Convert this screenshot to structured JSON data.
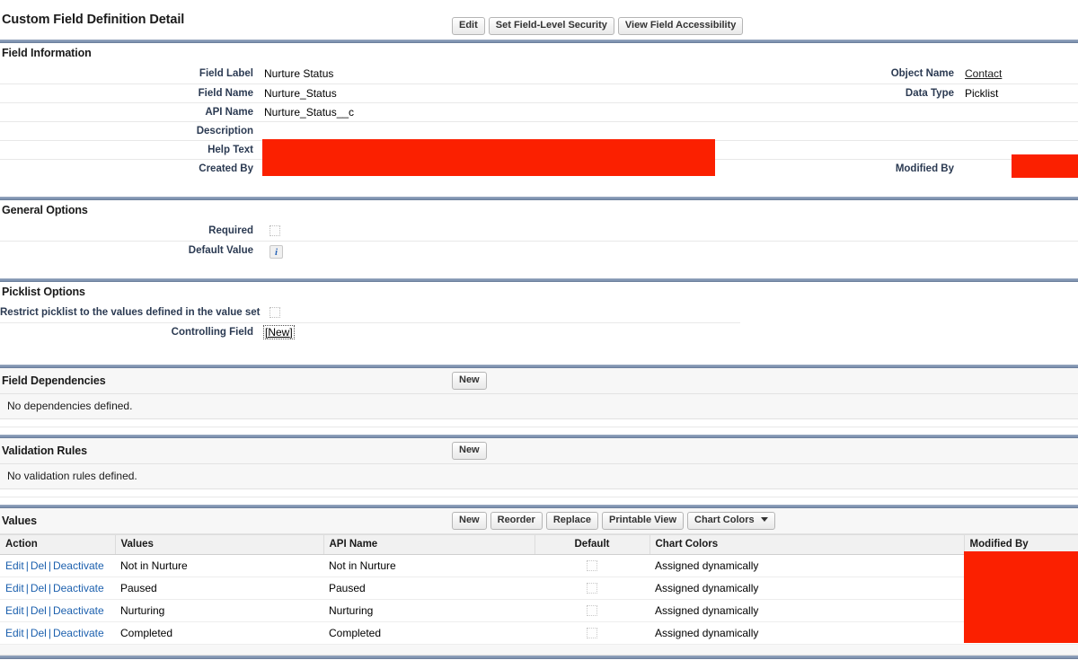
{
  "page": {
    "title": "Custom Field Definition Detail",
    "header_buttons": [
      {
        "label": "Edit",
        "name": "edit-button"
      },
      {
        "label": "Set Field-Level Security",
        "name": "set-field-level-security-button"
      },
      {
        "label": "View Field Accessibility",
        "name": "view-field-accessibility-button"
      }
    ]
  },
  "field_information": {
    "section_title": "Field Information",
    "left_rows": [
      {
        "label": "Field Label",
        "value": "Nurture Status"
      },
      {
        "label": "Field Name",
        "value": "Nurture_Status"
      },
      {
        "label": "API Name",
        "value": "Nurture_Status__c"
      },
      {
        "label": "Description",
        "value": ""
      },
      {
        "label": "Help Text",
        "value": ""
      },
      {
        "label": "Created By",
        "value": ""
      }
    ],
    "right_rows": [
      {
        "label": "Object Name",
        "value": "Contact",
        "link": true
      },
      {
        "label": "Data Type",
        "value": "Picklist",
        "link": false
      },
      {
        "label": "",
        "value": ""
      },
      {
        "label": "",
        "value": ""
      },
      {
        "label": "",
        "value": ""
      },
      {
        "label": "Modified By",
        "value": ""
      }
    ]
  },
  "general_options": {
    "section_title": "General Options",
    "rows": [
      {
        "label": "Required",
        "control": "checkbox-unchecked"
      },
      {
        "label": "Default Value",
        "control": "info-icon"
      }
    ]
  },
  "picklist_options": {
    "section_title": "Picklist Options",
    "restrict_label": "Restrict picklist to the values defined in the value set",
    "restrict_control": "checkbox-unchecked",
    "controlling_field_label": "Controlling Field",
    "controlling_field_value": "[New]"
  },
  "field_dependencies": {
    "title": "Field Dependencies",
    "new_button": "New",
    "empty_message": "No dependencies defined."
  },
  "validation_rules": {
    "title": "Validation Rules",
    "new_button": "New",
    "empty_message": "No validation rules defined."
  },
  "values": {
    "title": "Values",
    "buttons": [
      {
        "label": "New",
        "name": "values-new-button",
        "dropdown": false
      },
      {
        "label": "Reorder",
        "name": "values-reorder-button",
        "dropdown": false
      },
      {
        "label": "Replace",
        "name": "values-replace-button",
        "dropdown": false
      },
      {
        "label": "Printable View",
        "name": "values-printable-view-button",
        "dropdown": false
      },
      {
        "label": "Chart Colors",
        "name": "values-chart-colors-dropdown",
        "dropdown": true
      }
    ],
    "columns": [
      "Action",
      "Values",
      "API Name",
      "Default",
      "Chart Colors",
      "Modified By"
    ],
    "action_links": [
      "Edit",
      "Del",
      "Deactivate"
    ],
    "action_separator": "|",
    "rows": [
      {
        "value": "Not in Nurture",
        "api_name": "Not in Nurture",
        "default": false,
        "chart_colors": "Assigned dynamically",
        "modified_by": ""
      },
      {
        "value": "Paused",
        "api_name": "Paused",
        "default": false,
        "chart_colors": "Assigned dynamically",
        "modified_by": ""
      },
      {
        "value": "Nurturing",
        "api_name": "Nurturing",
        "default": false,
        "chart_colors": "Assigned dynamically",
        "modified_by": ""
      },
      {
        "value": "Completed",
        "api_name": "Completed",
        "default": false,
        "chart_colors": "Assigned dynamically",
        "modified_by": ""
      }
    ]
  },
  "colors": {
    "section_rule": "#8195b2",
    "redaction": "#fb2000",
    "link": "#1c60ae",
    "label_text": "#2b3a52"
  }
}
